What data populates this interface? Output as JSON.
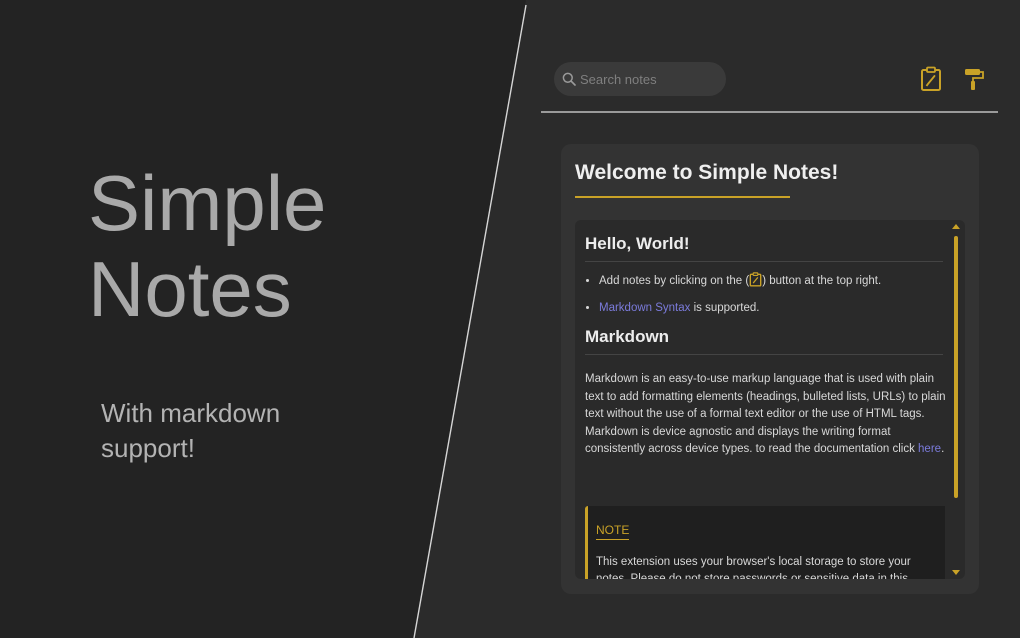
{
  "hero": {
    "title": "Simple Notes",
    "subtitle": "With markdown support!"
  },
  "search": {
    "placeholder": "Search notes",
    "value": ""
  },
  "toolbar": {
    "new_note_icon": "clipboard-pen-icon",
    "theme_icon": "paint-roller-icon"
  },
  "note": {
    "title": "Welcome to Simple Notes!",
    "heading1": "Hello, World!",
    "bullet1_before": "Add notes by clicking on the (",
    "bullet1_after": ") button at the top right.",
    "bullet2_link": "Markdown Syntax",
    "bullet2_after": " is supported.",
    "heading2": "Markdown",
    "paragraph": "Markdown is an easy-to-use markup language that is used with plain text to add formatting elements (headings, bulleted lists, URLs) to plain text without the use of a formal text editor or the use of HTML tags. Markdown is device agnostic and displays the writing format consistently across device types. to read the documentation click ",
    "paragraph_link": "here",
    "paragraph_end": ".",
    "callout_label": "NOTE",
    "callout_text": "This extension uses your browser's local storage to store your notes. Please do not store passwords or sensitive data in this extension."
  },
  "colors": {
    "accent": "#c9a227",
    "link": "#7b7bdb",
    "background": "#232323",
    "card": "#333333"
  }
}
